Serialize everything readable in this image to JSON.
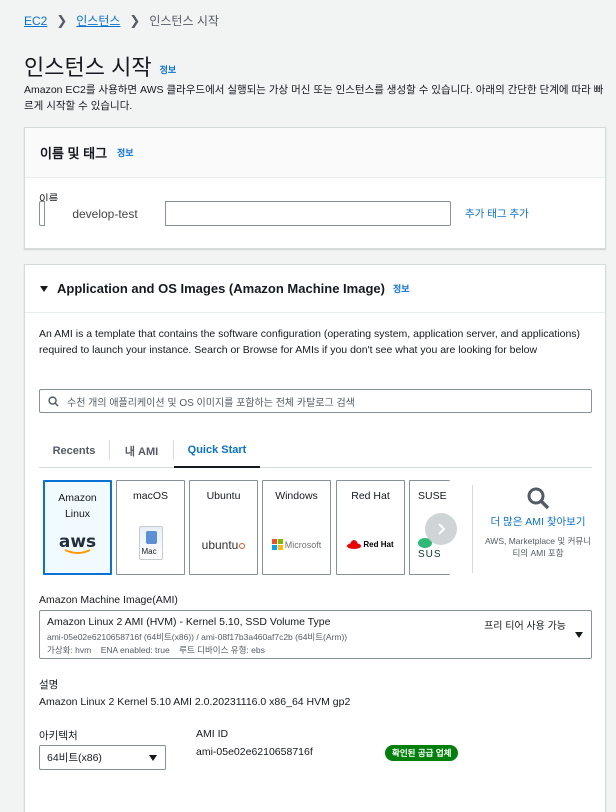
{
  "breadcrumb": {
    "root": "EC2",
    "parent": "인스턴스",
    "current": "인스턴스 시작"
  },
  "page": {
    "title": "인스턴스 시작",
    "info": "정보",
    "description": "Amazon EC2를 사용하면 AWS 클라우드에서 실행되는 가상 머신 또는 인스턴스를 생성할 수 있습니다. 아래의 간단한 단계에 따라 빠르게 시작할 수 있습니다."
  },
  "name_tags": {
    "header": "이름 및 태그",
    "info": "정보",
    "name_label": "이름",
    "name_value": "develop-test",
    "add_tag_link": "추가 태그 추가"
  },
  "ami": {
    "header": "Application and OS Images (Amazon Machine Image)",
    "info": "정보",
    "description": "An AMI is a template that contains the software configuration (operating system, application server, and applications) required to launch your instance. Search or Browse for AMIs if you don't see what you are looking for below",
    "search_placeholder": "수천 개의 애플리케이션 및 OS 이미지를 포함하는 전체 카탈로그 검색",
    "tabs": [
      {
        "label": "Recents"
      },
      {
        "label": "내 AMI"
      },
      {
        "label": "Quick Start"
      }
    ],
    "os_cards": [
      {
        "name": "Amazon Linux",
        "logo": "aws"
      },
      {
        "name": "macOS",
        "logo": "Mac"
      },
      {
        "name": "Ubuntu",
        "logo": "ubuntu"
      },
      {
        "name": "Windows",
        "logo": "Microsoft"
      },
      {
        "name": "Red Hat",
        "logo": "Red Hat"
      },
      {
        "name": "SUSE L",
        "logo": "SUS"
      }
    ],
    "more_ami_link": "더 많은 AMI 찾아보기",
    "more_ami_desc": "AWS, Marketplace 및 커뮤니티의 AMI 포함",
    "select_label": "Amazon Machine Image(AMI)",
    "selected_title": "Amazon Linux 2 AMI (HVM) - Kernel 5.10, SSD Volume Type",
    "selected_ids": "ami-05e02e6210658716f (64비트(x86)) / ami-08f17b3a460af7c2b (64비트(Arm))",
    "selected_details": "가상화: hvm    ENA enabled: true    루트 디바이스 유형: ebs",
    "free_tier": "프리 티어 사용 가능",
    "desc_label": "설명",
    "desc_value": "Amazon Linux 2 Kernel 5.10 AMI 2.0.20231116.0 x86_64 HVM gp2",
    "arch_label": "아키텍처",
    "arch_value": "64비트(x86)",
    "ami_id_label": "AMI ID",
    "ami_id_value": "ami-05e02e6210658716f",
    "verified_badge": "확인된 공급 업체"
  }
}
